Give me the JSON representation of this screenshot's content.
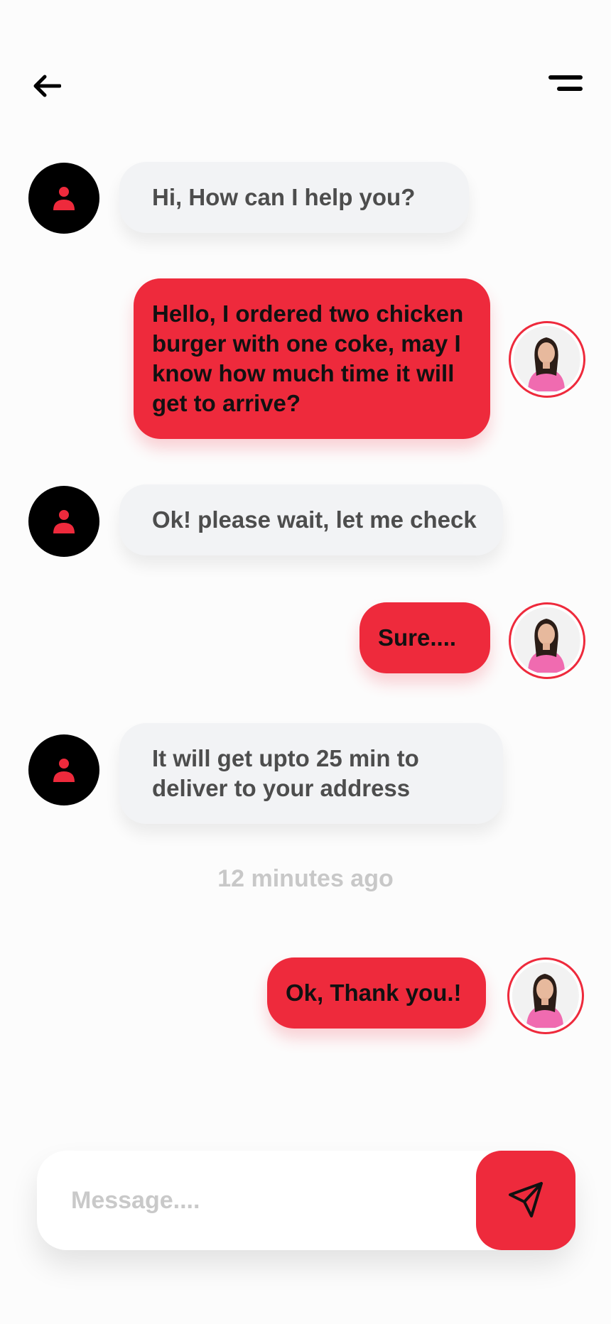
{
  "header": {
    "back_icon": "arrow-left-icon",
    "menu_icon": "menu-icon"
  },
  "messages": [
    {
      "sender": "support",
      "text": "Hi, How can I help you?"
    },
    {
      "sender": "user",
      "text": "Hello, I ordered two chicken burger with one coke, may I know how much time it will get to arrive?"
    },
    {
      "sender": "support",
      "text": "Ok! please wait, let me check"
    },
    {
      "sender": "user",
      "text": "Sure...."
    },
    {
      "sender": "support",
      "text": "It will get upto 25 min to deliver to your address"
    },
    {
      "sender": "user",
      "text": "Ok, Thank you.!"
    }
  ],
  "timestamp": "12 minutes ago",
  "composer": {
    "placeholder": "Message....",
    "value": "",
    "send_icon": "send-icon"
  },
  "colors": {
    "accent": "#ee2a3c",
    "incoming_bubble": "#f2f3f5",
    "incoming_text": "#4d4d4d",
    "timestamp_text": "#c8c8c8"
  }
}
